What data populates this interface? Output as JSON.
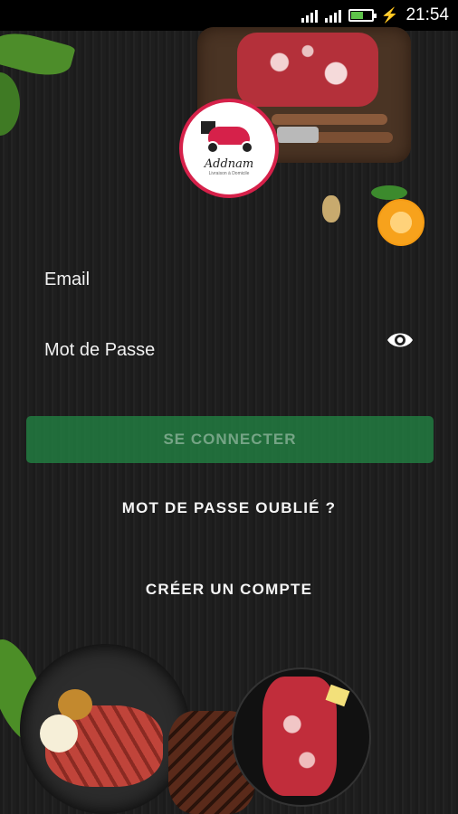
{
  "status_bar": {
    "time": "21:54",
    "battery_level": 0.6
  },
  "logo": {
    "name": "Addnam",
    "tagline": "Livraison à Domicile"
  },
  "form": {
    "email_label": "Email",
    "password_label": "Mot de Passe",
    "login_button": "SE CONNECTER",
    "forgot_password": "MOT DE PASSE OUBLIÉ ?",
    "create_account": "CRÉER UN COMPTE"
  },
  "colors": {
    "button_green": "#238c46",
    "logo_red": "#d6214a"
  }
}
